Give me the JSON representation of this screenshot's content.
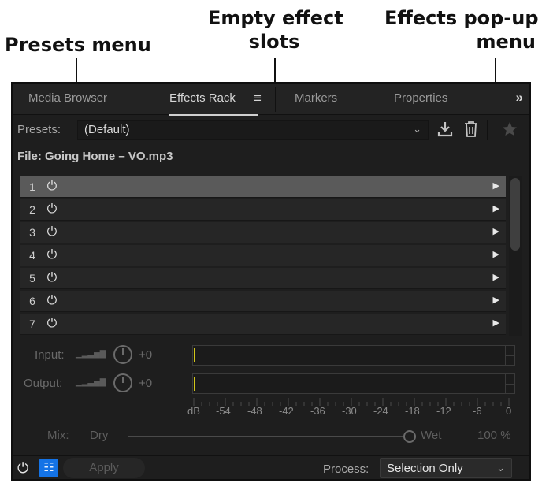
{
  "callouts": {
    "presets_menu": "Presets menu",
    "empty_slots_line1": "Empty effect",
    "empty_slots_line2": "slots",
    "effects_popup_line1": "Effects pop-up",
    "effects_popup_line2": "menu"
  },
  "tabs": [
    {
      "label": "Media Browser"
    },
    {
      "label": "Effects Rack",
      "active": true
    },
    {
      "label": "Markers"
    },
    {
      "label": "Properties"
    }
  ],
  "tab_menu_glyph": "≡",
  "overflow_glyph": "»",
  "presets": {
    "label": "Presets:",
    "value": "(Default)",
    "chevron": "⌄"
  },
  "file": "File: Going Home – VO.mp3",
  "slots": [
    {
      "num": "1",
      "selected": true
    },
    {
      "num": "2"
    },
    {
      "num": "3"
    },
    {
      "num": "4"
    },
    {
      "num": "5"
    },
    {
      "num": "6"
    },
    {
      "num": "7"
    }
  ],
  "input": {
    "label": "Input:",
    "value": "+0"
  },
  "output": {
    "label": "Output:",
    "value": "+0"
  },
  "meter_scale": [
    "dB",
    "-54",
    "-48",
    "-42",
    "-36",
    "-30",
    "-24",
    "-18",
    "-12",
    "-6",
    "0"
  ],
  "mix": {
    "label": "Mix:",
    "dry": "Dry",
    "wet": "Wet",
    "percent": "100 %",
    "level": 1.0
  },
  "bottom": {
    "apply": "Apply",
    "process_label": "Process:",
    "process_value": "Selection Only",
    "process_chevron": "⌄"
  },
  "icons": {
    "power": "power-icon",
    "download": "save-preset-icon",
    "trash": "delete-preset-icon",
    "star": "favorite-icon",
    "triangle": "effect-menu-triangle-icon",
    "list": "list-icon"
  }
}
